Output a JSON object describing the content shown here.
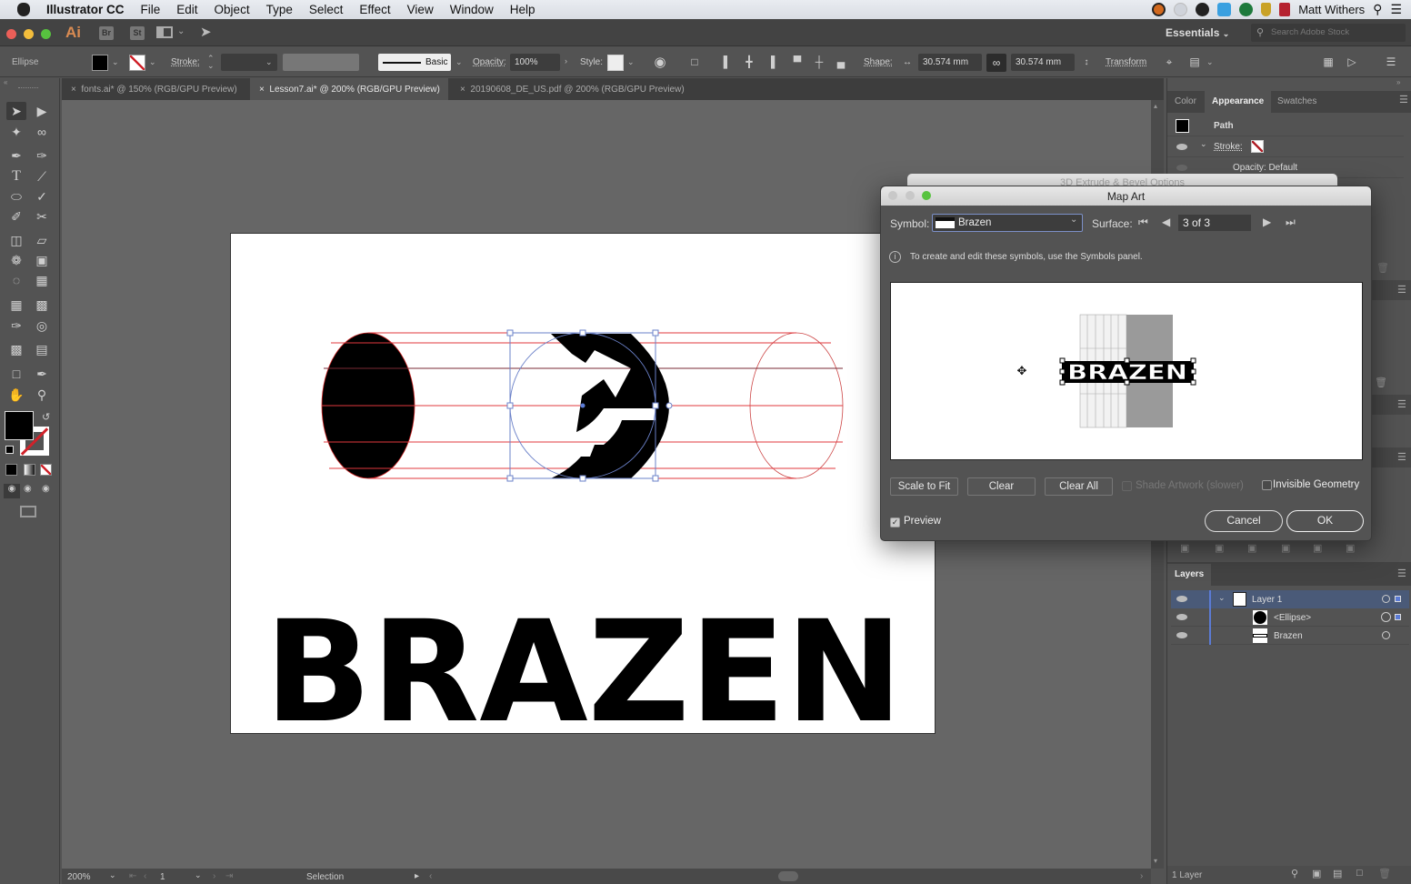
{
  "menubar": {
    "app_name": "Illustrator CC",
    "items": [
      "File",
      "Edit",
      "Object",
      "Type",
      "Select",
      "Effect",
      "View",
      "Window",
      "Help"
    ],
    "user": "Matt Withers"
  },
  "appbar": {
    "logo": "Ai",
    "bridge": "Br",
    "stock": "St",
    "workspace": "Essentials",
    "stock_search_placeholder": "Search Adobe Stock"
  },
  "control_bar": {
    "object_type": "Ellipse",
    "stroke_label": "Stroke:",
    "stroke_weight": "",
    "brush_label": "Basic",
    "opacity_label": "Opacity:",
    "opacity_value": "100%",
    "style_label": "Style:",
    "shape_label": "Shape:",
    "width_value": "30.574 mm",
    "height_value": "30.574 mm",
    "transform_label": "Transform"
  },
  "doc_tabs": [
    {
      "label": "fonts.ai* @ 150% (RGB/GPU Preview)",
      "active": false
    },
    {
      "label": "Lesson7.ai* @ 200% (RGB/GPU Preview)",
      "active": true
    },
    {
      "label": "20190608_DE_US.pdf @ 200% (RGB/GPU Preview)",
      "active": false
    }
  ],
  "status_bar": {
    "zoom": "200%",
    "artboard_number": "1",
    "tool_name": "Selection"
  },
  "artboard": {
    "text": "BRAZEN"
  },
  "colors": {
    "fill": "#000000",
    "guide_red": "#e0383e",
    "selection_blue": "#5b7bd5",
    "layer_highlight": "#4a5a78"
  },
  "appearance_panel": {
    "tabs": [
      "Color",
      "Appearance",
      "Swatches"
    ],
    "active_tab": "Appearance",
    "path_label": "Path",
    "stroke_label": "Stroke:",
    "opacity_label": "Opacity: Default"
  },
  "layers_panel": {
    "title": "Layers",
    "layers": [
      {
        "name": "Layer 1",
        "level": 0,
        "expanded": true,
        "selected": true
      },
      {
        "name": "<Ellipse>",
        "level": 1,
        "selected": false
      },
      {
        "name": "Brazen",
        "level": 1,
        "selected": false
      }
    ],
    "footer": "1 Layer"
  },
  "behind_dialog": {
    "title": "3D Extrude & Bevel Options"
  },
  "map_art_dialog": {
    "title": "Map Art",
    "symbol_label": "Symbol:",
    "symbol_value": "Brazen",
    "surface_label": "Surface:",
    "surface_value": "3 of 3",
    "info_text": "To create and edit these symbols, use the Symbols panel.",
    "preview_text": "BRAZEN",
    "buttons": {
      "scale_to_fit": "Scale to Fit",
      "clear": "Clear",
      "clear_all": "Clear All",
      "cancel": "Cancel",
      "ok": "OK"
    },
    "shade_artwork": {
      "label": "Shade Artwork (slower)",
      "checked": false,
      "enabled": false
    },
    "invisible_geometry": {
      "label": "Invisible Geometry",
      "checked": false
    },
    "preview": {
      "label": "Preview",
      "checked": true
    }
  }
}
